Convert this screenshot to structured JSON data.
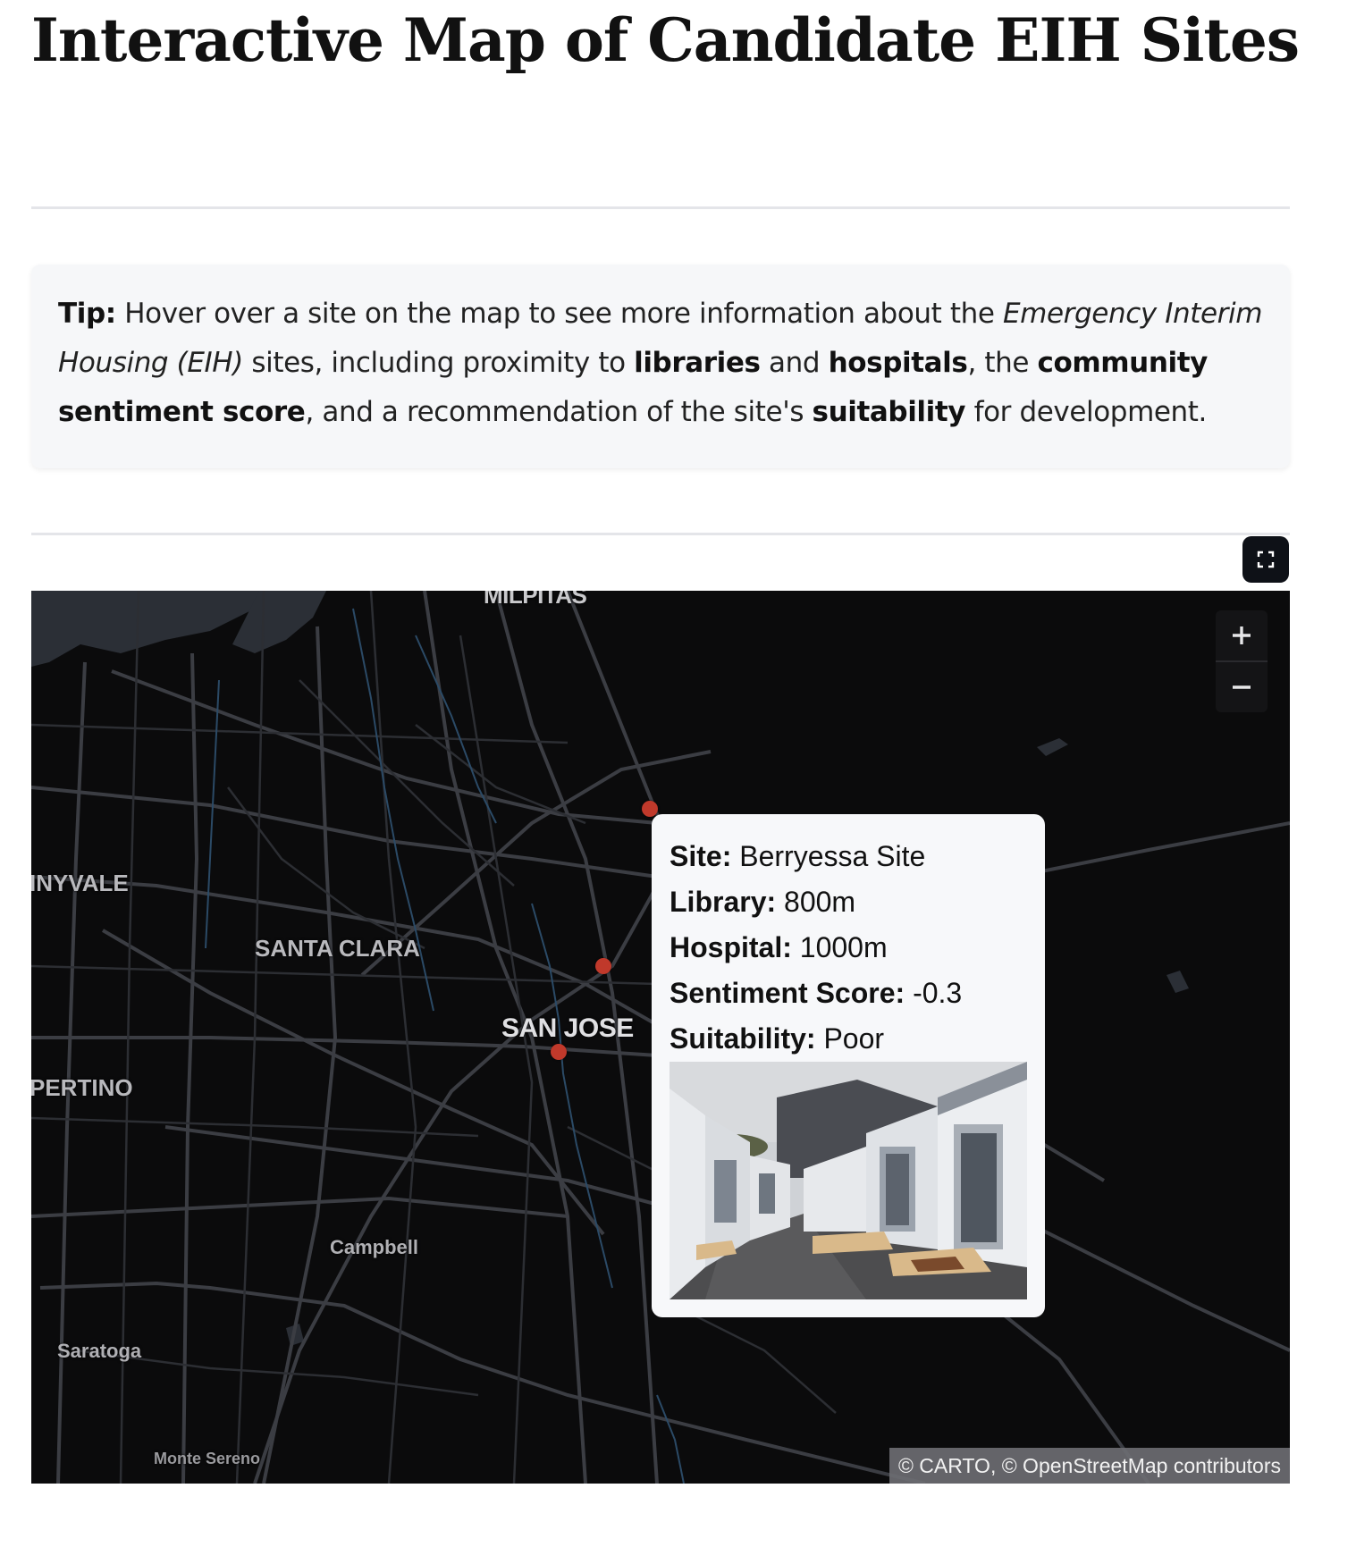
{
  "page": {
    "title": "Interactive Map of Candidate EIH Sites"
  },
  "tip": {
    "label": "Tip:",
    "t1": " Hover over a site on the map to see more information about the ",
    "italic": "Emergency Interim Housing (EIH)",
    "t2": " sites, including proximity to ",
    "b1": "libraries",
    "t3": " and ",
    "b2": "hospitals",
    "t4": ", the ",
    "b3": "community sentiment score",
    "t5": ", and a recommendation of the site's ",
    "b4": "suitability",
    "t6": " for development."
  },
  "map": {
    "labels": {
      "milpitas": "MILPITAS",
      "sunnyvale": "INYVALE",
      "santa_clara": "SANTA CLARA",
      "san_jose": "SAN JOSE",
      "cupertino": "PERTINO",
      "campbell": "Campbell",
      "saratoga": "Saratoga",
      "monte_sereno": "Monte Sereno"
    },
    "attribution": "© CARTO, © OpenStreetMap contributors",
    "marker_color": "#c0392b",
    "icons": {
      "zoom_in": "plus-icon",
      "zoom_out": "minus-icon",
      "fullscreen": "fullscreen-icon"
    }
  },
  "tooltip": {
    "site_label": "Site:",
    "site_value": " Berryessa Site",
    "library_label": "Library:",
    "library_value": " 800m",
    "hospital_label": "Hospital:",
    "hospital_value": " 1000m",
    "sentiment_label": "Sentiment Score:",
    "sentiment_value": " -0.3",
    "suitability_label": "Suitability:",
    "suitability_value": " Poor"
  }
}
